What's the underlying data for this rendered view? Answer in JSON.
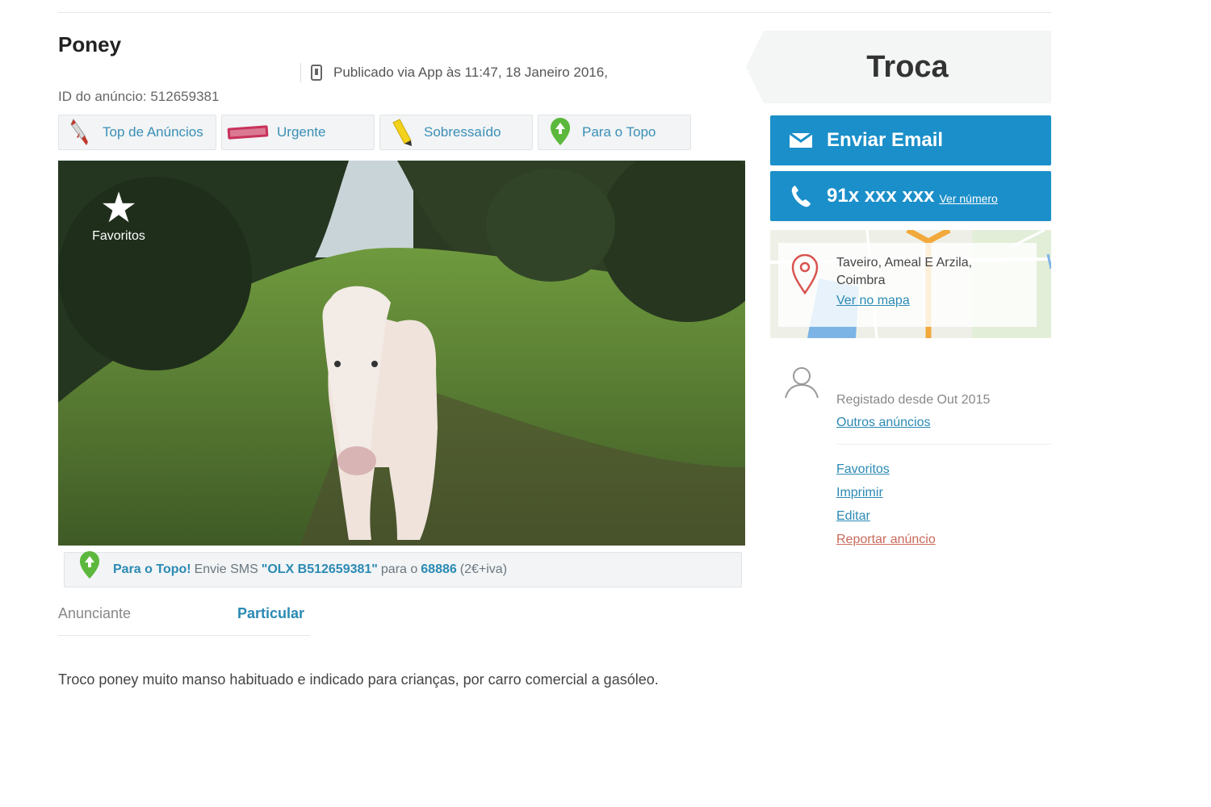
{
  "listing": {
    "title": "Poney",
    "published": "Publicado via App às 11:47, 18 Janeiro 2016,",
    "ad_id": "ID do anúncio: 512659381",
    "description": "Troco poney muito manso habituado e indicado para crianças, por carro comercial a gasóleo."
  },
  "promotions": [
    {
      "label": "Top de Anúncios",
      "icon": "rocket-icon"
    },
    {
      "label": "Urgente",
      "icon": "urgente-badge-icon"
    },
    {
      "label": "Sobressaído",
      "icon": "highlighter-icon"
    },
    {
      "label": "Para o Topo",
      "icon": "up-arrow-badge-icon"
    }
  ],
  "photo": {
    "favorite_label": "Favoritos"
  },
  "sms_bar": {
    "lead": "Para o Topo!",
    "text1": "Envie SMS",
    "code": "\"OLX B512659381\"",
    "text2": "para o",
    "number": "68886",
    "price": "(2€+iva)"
  },
  "advertiser": {
    "label": "Anunciante",
    "value": "Particular"
  },
  "sidebar": {
    "price_type": "Troca",
    "email_button": "Enviar Email",
    "phone_masked": "91x xxx xxx",
    "phone_reveal": "Ver número",
    "location_line1": "Taveiro, Ameal E Arzila,",
    "location_line2": "Coimbra",
    "map_link": "Ver no mapa",
    "registered": "Registado desde Out 2015",
    "other_ads": "Outros anúncios",
    "links": {
      "favorites": "Favoritos",
      "print": "Imprimir",
      "edit": "Editar",
      "report": "Reportar anúncio"
    }
  },
  "colors": {
    "accent_blue": "#1b8fc9",
    "link_blue": "#2b8ab4",
    "report_red": "#c96a5a"
  }
}
